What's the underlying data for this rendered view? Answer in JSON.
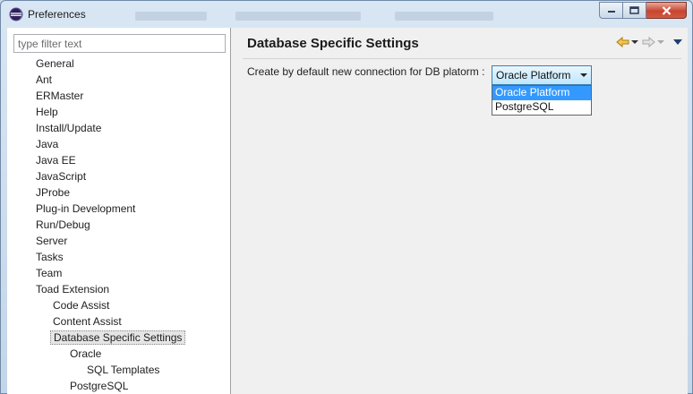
{
  "window": {
    "title": "Preferences"
  },
  "filter": {
    "placeholder": "type filter text"
  },
  "tree": [
    {
      "label": "General",
      "level": 0
    },
    {
      "label": "Ant",
      "level": 0
    },
    {
      "label": "ERMaster",
      "level": 0
    },
    {
      "label": "Help",
      "level": 0
    },
    {
      "label": "Install/Update",
      "level": 0
    },
    {
      "label": "Java",
      "level": 0
    },
    {
      "label": "Java EE",
      "level": 0
    },
    {
      "label": "JavaScript",
      "level": 0
    },
    {
      "label": "JProbe",
      "level": 0
    },
    {
      "label": "Plug-in Development",
      "level": 0
    },
    {
      "label": "Run/Debug",
      "level": 0
    },
    {
      "label": "Server",
      "level": 0
    },
    {
      "label": "Tasks",
      "level": 0
    },
    {
      "label": "Team",
      "level": 0
    },
    {
      "label": "Toad Extension",
      "level": 0
    },
    {
      "label": "Code Assist",
      "level": 1
    },
    {
      "label": "Content Assist",
      "level": 1
    },
    {
      "label": "Database Specific Settings",
      "level": 1,
      "selected": true
    },
    {
      "label": "Oracle",
      "level": 2
    },
    {
      "label": "SQL Templates",
      "level": 3
    },
    {
      "label": "PostgreSQL",
      "level": 2
    }
  ],
  "page": {
    "title": "Database Specific Settings",
    "setting_label": "Create by default new connection for DB platorm :",
    "selected_platform": "Oracle Platform",
    "options": [
      {
        "label": "Oracle Platform",
        "highlighted": true
      },
      {
        "label": "PostgreSQL",
        "highlighted": false
      }
    ]
  },
  "icons": {
    "window": "eclipse-icon",
    "back": "back-arrow-icon",
    "forward": "forward-arrow-icon",
    "menu": "view-menu-icon"
  },
  "colors": {
    "highlight": "#3399ff",
    "back_arrow": "#e6a817"
  }
}
